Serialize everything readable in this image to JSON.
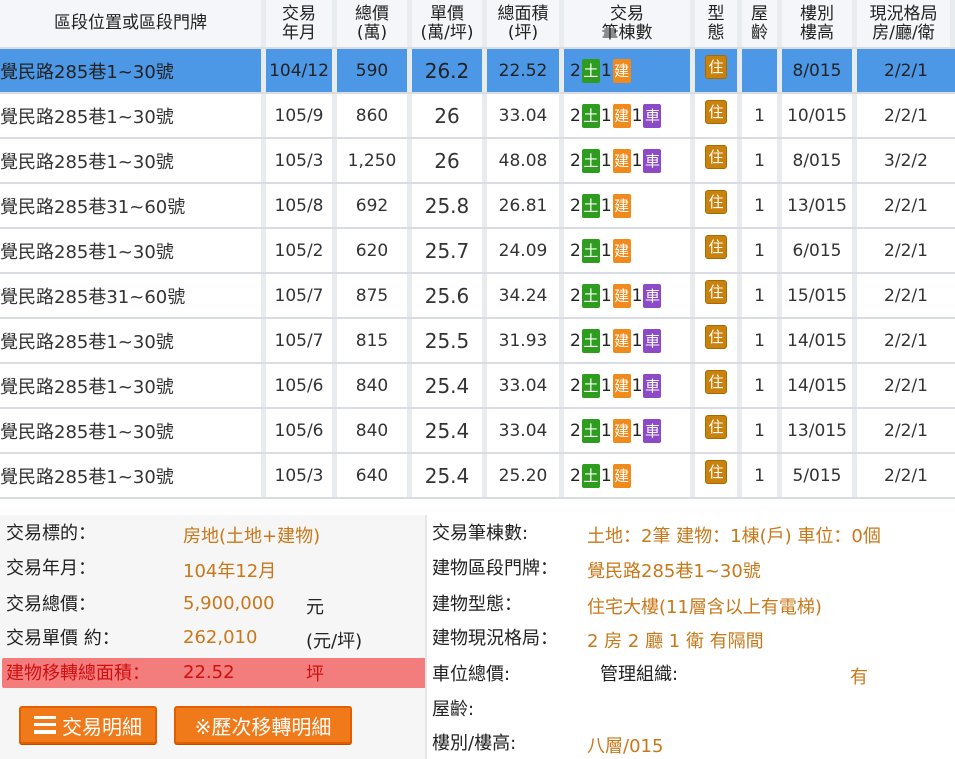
{
  "table": {
    "headers": {
      "addr": "區段位置或區段門牌",
      "ym_1": "交易",
      "ym_2": "年月",
      "total_1": "總價",
      "total_2": "(萬)",
      "unit_1": "單價",
      "unit_2": "(萬/坪)",
      "area_1": "總面積",
      "area_2": "(坪)",
      "txn_1": "交易",
      "txn_2": "筆棟數",
      "type_1": "型",
      "type_2": "態",
      "age_1": "屋",
      "age_2": "齡",
      "floor_1": "樓別",
      "floor_2": "樓高",
      "layout_1": "現況格局",
      "layout_2": "房/廳/衛"
    },
    "badge_labels": {
      "land": "土",
      "bld": "建",
      "car": "車",
      "res": "住"
    },
    "rows": [
      {
        "addr": "覺民路285巷1~30號",
        "ym": "104/12",
        "total": "590",
        "unit": "26.2",
        "area": "22.52",
        "land": "2",
        "bld": "1",
        "car": "",
        "age": "",
        "floor": "8/015",
        "layout": "2/2/1"
      },
      {
        "addr": "覺民路285巷1~30號",
        "ym": "105/9",
        "total": "860",
        "unit": "26",
        "area": "33.04",
        "land": "2",
        "bld": "1",
        "car": "1",
        "age": "1",
        "floor": "10/015",
        "layout": "2/2/1"
      },
      {
        "addr": "覺民路285巷1~30號",
        "ym": "105/3",
        "total": "1,250",
        "unit": "26",
        "area": "48.08",
        "land": "2",
        "bld": "1",
        "car": "1",
        "age": "1",
        "floor": "8/015",
        "layout": "3/2/2"
      },
      {
        "addr": "覺民路285巷31~60號",
        "ym": "105/8",
        "total": "692",
        "unit": "25.8",
        "area": "26.81",
        "land": "2",
        "bld": "1",
        "car": "",
        "age": "1",
        "floor": "13/015",
        "layout": "2/2/1"
      },
      {
        "addr": "覺民路285巷1~30號",
        "ym": "105/2",
        "total": "620",
        "unit": "25.7",
        "area": "24.09",
        "land": "2",
        "bld": "1",
        "car": "",
        "age": "1",
        "floor": "6/015",
        "layout": "2/2/1"
      },
      {
        "addr": "覺民路285巷31~60號",
        "ym": "105/7",
        "total": "875",
        "unit": "25.6",
        "area": "34.24",
        "land": "2",
        "bld": "1",
        "car": "1",
        "age": "1",
        "floor": "15/015",
        "layout": "2/2/1"
      },
      {
        "addr": "覺民路285巷1~30號",
        "ym": "105/7",
        "total": "815",
        "unit": "25.5",
        "area": "31.93",
        "land": "2",
        "bld": "1",
        "car": "1",
        "age": "1",
        "floor": "14/015",
        "layout": "2/2/1"
      },
      {
        "addr": "覺民路285巷1~30號",
        "ym": "105/6",
        "total": "840",
        "unit": "25.4",
        "area": "33.04",
        "land": "2",
        "bld": "1",
        "car": "1",
        "age": "1",
        "floor": "14/015",
        "layout": "2/2/1"
      },
      {
        "addr": "覺民路285巷1~30號",
        "ym": "105/6",
        "total": "840",
        "unit": "25.4",
        "area": "33.04",
        "land": "2",
        "bld": "1",
        "car": "1",
        "age": "1",
        "floor": "13/015",
        "layout": "2/2/1"
      },
      {
        "addr": "覺民路285巷1~30號",
        "ym": "105/3",
        "total": "640",
        "unit": "25.4",
        "area": "25.20",
        "land": "2",
        "bld": "1",
        "car": "",
        "age": "1",
        "floor": "5/015",
        "layout": "2/2/1"
      }
    ]
  },
  "detail": {
    "left": {
      "subject_label": "交易標的：",
      "subject_value": "房地(土地+建物)",
      "ym_label": "交易年月：",
      "ym_value": "104年12月",
      "total_label": "交易總價：",
      "total_value": "5,900,000",
      "total_unit": "元",
      "unit_label": "交易單價 約：",
      "unit_value": "262,010",
      "unit_unit": "(元/坪)",
      "area_label": "建物移轉總面積：",
      "area_value": "22.52",
      "area_unit": "坪"
    },
    "right": {
      "count_label": "交易筆棟數:",
      "count_value": "土地：2筆 建物：1棟(戶) 車位：0個",
      "addr_label": "建物區段門牌：",
      "addr_value": "覺民路285巷1~30號",
      "type_label": "建物型態：",
      "type_value": "住宅大樓(11層含以上有電梯)",
      "layout_label": "建物現況格局：",
      "layout_value": "2 房 2 廳 1 衛 有隔間",
      "parking_label": "車位總價:",
      "mgmt_label": "管理組織:",
      "mgmt_value": "有",
      "age_label": "屋齡:",
      "floor_label": "樓別/樓高:",
      "floor_value": "八層/015"
    },
    "buttons": {
      "detail": "交易明細",
      "history": "※歷次移轉明細"
    }
  }
}
